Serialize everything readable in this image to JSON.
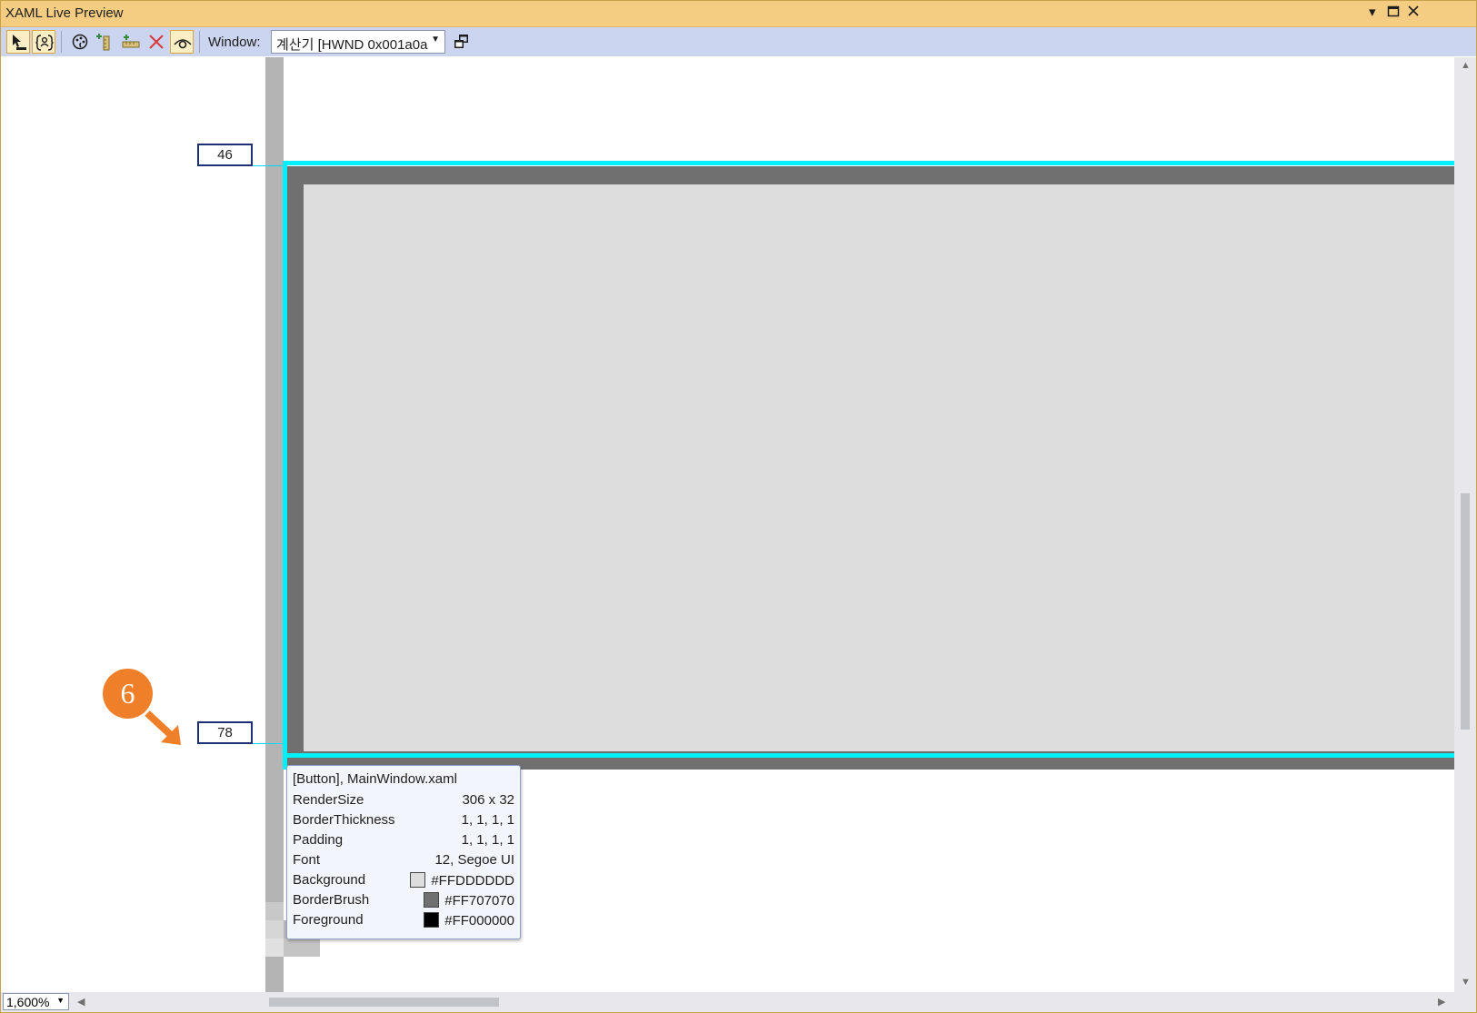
{
  "window": {
    "title": "XAML Live Preview"
  },
  "titlebar_icons": [
    "dropdown-arrow-icon",
    "maximize-icon",
    "close-icon"
  ],
  "toolbar": {
    "buttons": [
      {
        "name": "select-element-icon",
        "active": true
      },
      {
        "name": "display-layout-adorners-icon",
        "active": true
      },
      {
        "name": "track-focused-element-icon",
        "active": false
      },
      {
        "name": "display-layout-rulers-icon",
        "active": false
      },
      {
        "name": "display-ruler-icon",
        "active": false
      },
      {
        "name": "clear-rulers-icon",
        "active": false
      },
      {
        "name": "preview-selection-icon",
        "active": true
      }
    ],
    "window_label": "Window:",
    "window_value": "계산기 [HWND 0x001a0a",
    "detach_icon": "popout-window-icon"
  },
  "rulers": {
    "top_value": "46",
    "bottom_value": "78"
  },
  "callout": {
    "number": "6",
    "color": "#f07f2a"
  },
  "tooltip": {
    "header": "[Button], MainWindow.xaml",
    "rows": [
      {
        "name": "RenderSize",
        "value": "306 x 32"
      },
      {
        "name": "BorderThickness",
        "value": "1, 1, 1, 1"
      },
      {
        "name": "Padding",
        "value": "1, 1, 1, 1"
      },
      {
        "name": "Font",
        "value": "12, Segoe UI"
      },
      {
        "name": "Background",
        "value": "#FFDDDDDD",
        "swatch": "#dddddd"
      },
      {
        "name": "BorderBrush",
        "value": "#FF707070",
        "swatch": "#707070"
      },
      {
        "name": "Foreground",
        "value": "#FF000000",
        "swatch": "#000000"
      }
    ]
  },
  "colors": {
    "selection": "#00f0ff",
    "button_background": "#dddddd",
    "button_border": "#707070",
    "titlebar": "#f5cd82",
    "toolbar": "#ccd5f0"
  },
  "status": {
    "zoom": "1,600%"
  }
}
